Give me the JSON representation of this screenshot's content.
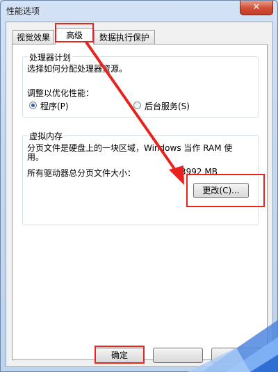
{
  "window": {
    "title": "性能选项",
    "close_glyph": "✕"
  },
  "tabs": [
    {
      "label": "视觉效果",
      "active": false
    },
    {
      "label": "高级",
      "active": true
    },
    {
      "label": "数据执行保护",
      "active": false
    }
  ],
  "processor": {
    "group_title": "处理器计划",
    "description": "选择如何分配处理器资源。",
    "optimize_label": "调整以优化性能：",
    "options": [
      {
        "label": "程序(P)",
        "selected": true
      },
      {
        "label": "后台服务(S)",
        "selected": false
      }
    ]
  },
  "virtual_memory": {
    "group_title": "虚拟内存",
    "description_line1": "分页文件是硬盘上的一块区域，Windows 当作 RAM 使",
    "description_line2": "用。",
    "total_label": "所有驱动器总分页文件大小：",
    "total_value": "3992 MB",
    "change_button": "更改(C)..."
  },
  "footer": {
    "ok_button": "确定"
  },
  "annotation": {
    "highlight_color": "#e8231f"
  }
}
